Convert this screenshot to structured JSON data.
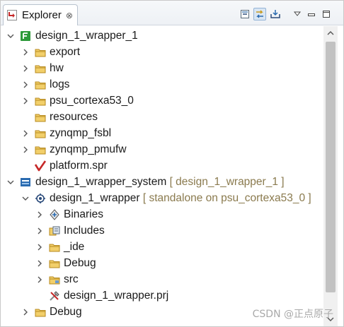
{
  "tab": {
    "title": "Explorer",
    "close_glyph": "⊗"
  },
  "toolbar": {
    "buttons": [
      {
        "name": "collapse-all-icon"
      },
      {
        "name": "link-with-editor-icon",
        "active": true
      },
      {
        "name": "import-icon"
      },
      {
        "name": "view-menu-icon"
      },
      {
        "name": "minimize-icon"
      },
      {
        "name": "maximize-icon"
      }
    ]
  },
  "tree": {
    "platform": {
      "label": "design_1_wrapper_1",
      "children": {
        "export": "export",
        "hw": "hw",
        "logs": "logs",
        "psu": "psu_cortexa53_0",
        "resources": "resources",
        "fsbl": "zynqmp_fsbl",
        "pmufw": "zynqmp_pmufw",
        "spr": "platform.spr"
      }
    },
    "system": {
      "label": "design_1_wrapper_system",
      "decoration": "[ design_1_wrapper_1 ]",
      "app": {
        "label": "design_1_wrapper",
        "decoration": "[ standalone on psu_cortexa53_0 ]",
        "children": {
          "binaries": "Binaries",
          "includes": "Includes",
          "ide": "_ide",
          "debug": "Debug",
          "src": "src",
          "prj": "design_1_wrapper.prj"
        }
      }
    },
    "debug": "Debug"
  },
  "watermark": "CSDN @正点原子",
  "colors": {
    "folder": "#e8b84a",
    "accent": "#2f7d32",
    "selection": "#d9e6f3"
  }
}
